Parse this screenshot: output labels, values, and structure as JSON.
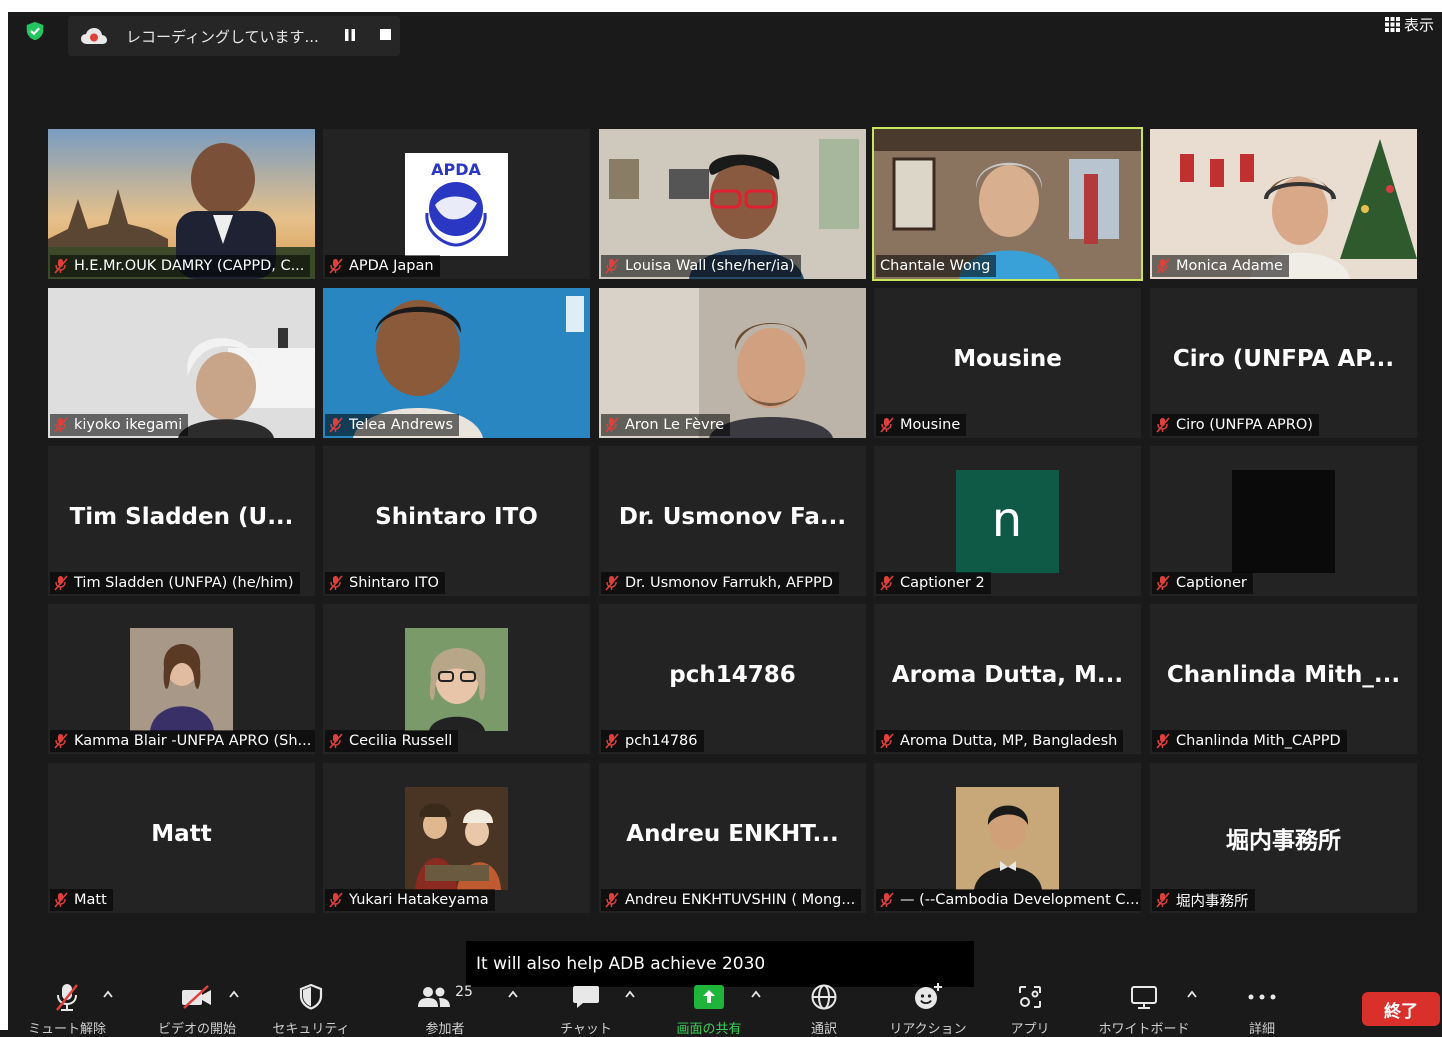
{
  "top_bar": {
    "recording_label": "レコーディングしています...",
    "view_label": "表示"
  },
  "tiles": [
    {
      "name": "H.E.Mr.OUK DAMRY (CAPPD, C...",
      "big_name": "",
      "video": "angkor"
    },
    {
      "name": "APDA Japan",
      "big_name": "",
      "video": "apda-logo"
    },
    {
      "name": "Louisa Wall (she/her/ia)",
      "big_name": "",
      "video": "room-woman"
    },
    {
      "name": "Chantale Wong",
      "big_name": "",
      "video": "office-woman"
    },
    {
      "name": "Monica Adame",
      "big_name": "",
      "video": "christmas"
    },
    {
      "name": "kiyoko ikegami",
      "big_name": "",
      "video": "white-room"
    },
    {
      "name": "Telea Andrews",
      "big_name": "",
      "video": "un-blue"
    },
    {
      "name": "Aron Le Fèvre",
      "big_name": "",
      "video": "room-man"
    },
    {
      "name": "Mousine",
      "big_name": "Mousine",
      "video": ""
    },
    {
      "name": "Ciro (UNFPA APRO)",
      "big_name": "Ciro (UNFPA AP...",
      "video": ""
    },
    {
      "name": "Tim Sladden (UNFPA) (he/him)",
      "big_name": "Tim Sladden (U...",
      "video": ""
    },
    {
      "name": "Shintaro ITO",
      "big_name": "Shintaro ITO",
      "video": ""
    },
    {
      "name": "Dr. Usmonov Farrukh, AFPPD",
      "big_name": "Dr. Usmonov Fa...",
      "video": ""
    },
    {
      "name": "Captioner 2",
      "big_name": "",
      "video": "n-avatar"
    },
    {
      "name": "Captioner",
      "big_name": "",
      "video": "black-avatar"
    },
    {
      "name": "Kamma Blair -UNFPA APRO (Sh...",
      "big_name": "",
      "video": "photo-woman-1"
    },
    {
      "name": "Cecilia Russell",
      "big_name": "",
      "video": "photo-woman-2"
    },
    {
      "name": "pch14786",
      "big_name": "pch14786",
      "video": ""
    },
    {
      "name": "Aroma Dutta, MP, Bangladesh",
      "big_name": "Aroma Dutta, M...",
      "video": ""
    },
    {
      "name": "Chanlinda Mith_CAPPD",
      "big_name": "Chanlinda Mith_...",
      "video": ""
    },
    {
      "name": "Matt",
      "big_name": "Matt",
      "video": ""
    },
    {
      "name": "Yukari Hatakeyama",
      "big_name": "",
      "video": "painting"
    },
    {
      "name": "Andreu ENKHTUVSHIN ( Mong...",
      "big_name": "Andreu ENKHT...",
      "video": ""
    },
    {
      "name": "— (--Cambodia Development C...",
      "big_name": "",
      "video": "photo-man"
    },
    {
      "name": "堀内事務所",
      "big_name": "堀内事務所",
      "video": ""
    }
  ],
  "caption": "It will also help ADB achieve 2030",
  "toolbar": {
    "mute": "ミュート解除",
    "video": "ビデオの開始",
    "security": "セキュリティ",
    "participants": "参加者",
    "participants_count": "25",
    "chat": "チャット",
    "share": "画面の共有",
    "interpretation": "通訳",
    "reactions": "リアクション",
    "apps": "アプリ",
    "whiteboard": "ホワイトボード",
    "more": "詳細",
    "end": "終了"
  },
  "colors": {
    "active_speaker": "#c8e65a",
    "end_button": "#d9302c",
    "share_button": "#1fb53b",
    "muted_icon": "#e0403a"
  }
}
